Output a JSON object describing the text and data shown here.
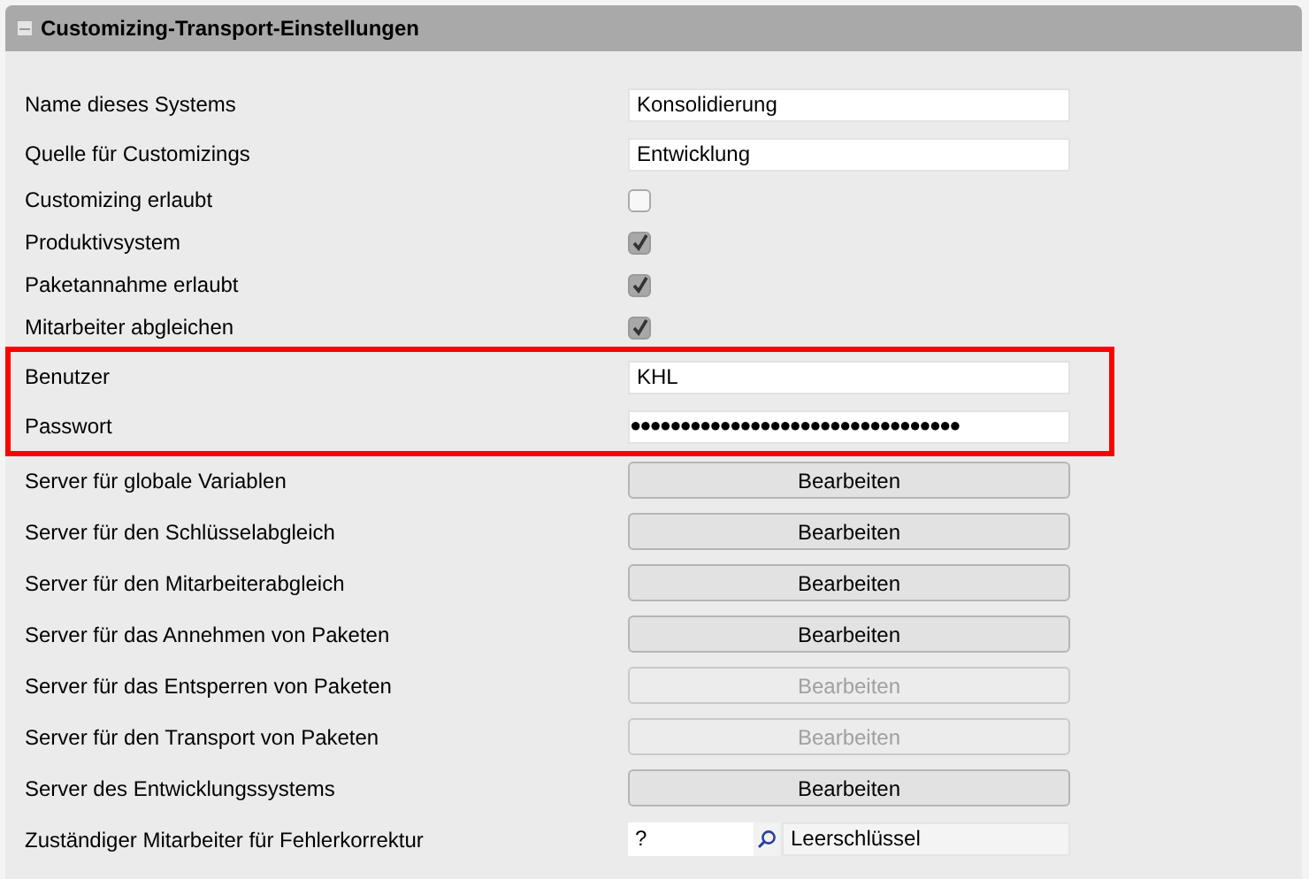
{
  "panel": {
    "title": "Customizing-Transport-Einstellungen",
    "expanded": true
  },
  "rows": [
    {
      "label": "Name dieses Systems",
      "kind": "text",
      "value": "Konsolidierung",
      "highlighted": false
    },
    {
      "label": "Quelle für Customizings",
      "kind": "text",
      "value": "Entwicklung",
      "highlighted": false
    },
    {
      "label": "Customizing erlaubt",
      "kind": "checkbox",
      "checked": false,
      "highlighted": false
    },
    {
      "label": "Produktivsystem",
      "kind": "checkbox",
      "checked": true,
      "highlighted": false
    },
    {
      "label": "Paketannahme erlaubt",
      "kind": "checkbox",
      "checked": true,
      "highlighted": false
    },
    {
      "label": "Mitarbeiter abgleichen",
      "kind": "checkbox",
      "checked": true,
      "highlighted": false
    },
    {
      "label": "Benutzer",
      "kind": "text",
      "value": "KHL",
      "highlighted": true
    },
    {
      "label": "Passwort",
      "kind": "password",
      "value": "●●●●●●●●●●●●●●●●●●●●●●●●●●●●●●●●●",
      "highlighted": true
    },
    {
      "label": "Server für globale Variablen",
      "kind": "button",
      "button": "Bearbeiten",
      "disabled": false,
      "highlighted": false
    },
    {
      "label": "Server für den Schlüsselabgleich",
      "kind": "button",
      "button": "Bearbeiten",
      "disabled": false,
      "highlighted": false
    },
    {
      "label": "Server für den Mitarbeiterabgleich",
      "kind": "button",
      "button": "Bearbeiten",
      "disabled": false,
      "highlighted": false
    },
    {
      "label": "Server für das Annehmen von Paketen",
      "kind": "button",
      "button": "Bearbeiten",
      "disabled": false,
      "highlighted": false
    },
    {
      "label": "Server für das Entsperren von Paketen",
      "kind": "button",
      "button": "Bearbeiten",
      "disabled": true,
      "highlighted": false
    },
    {
      "label": "Server für den Transport von Paketen",
      "kind": "button",
      "button": "Bearbeiten",
      "disabled": true,
      "highlighted": false
    },
    {
      "label": "Server des Entwicklungssystems",
      "kind": "button",
      "button": "Bearbeiten",
      "disabled": false,
      "highlighted": false
    },
    {
      "label": "Zuständiger Mitarbeiter für Fehlerkorrektur",
      "kind": "lookup",
      "value": "?",
      "description": "Leerschlüssel",
      "highlighted": false
    }
  ]
}
